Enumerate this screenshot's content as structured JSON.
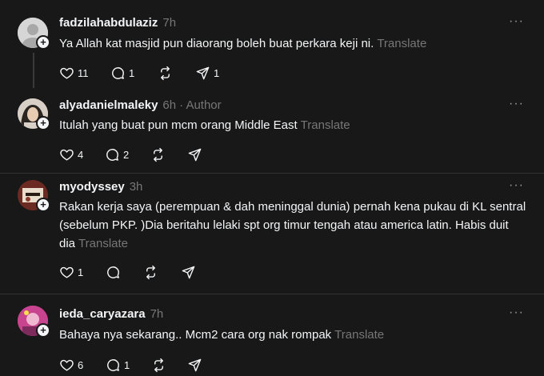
{
  "comments": [
    {
      "username": "fadzilahabdulaziz",
      "time": "7h",
      "author": "",
      "text": "Ya Allah kat masjid pun diaorang boleh buat perkara keji ni.",
      "translate": "Translate",
      "likes": "11",
      "replies": "1",
      "reposts": "",
      "shares": "1"
    },
    {
      "username": "alyadanielmaleky",
      "time": "6h",
      "author": "· Author",
      "text": "Itulah yang buat pun mcm orang Middle East",
      "translate": "Translate",
      "likes": "4",
      "replies": "2",
      "reposts": "",
      "shares": ""
    },
    {
      "username": "myodyssey",
      "time": "3h",
      "author": "",
      "text": "Rakan kerja saya (perempuan & dah meninggal dunia) pernah kena pukau di KL sentral (sebelum PKP. )Dia beritahu lelaki spt org timur tengah atau america latin. Habis duit dia",
      "translate": "Translate",
      "likes": "1",
      "replies": "",
      "reposts": "",
      "shares": ""
    },
    {
      "username": "ieda_caryazara",
      "time": "7h",
      "author": "",
      "text": "Bahaya nya sekarang.. Mcm2 cara org nak rompak",
      "translate": "Translate",
      "likes": "6",
      "replies": "1",
      "reposts": "",
      "shares": ""
    }
  ],
  "more_icon": "···",
  "colors": {
    "background": "#181818",
    "text": "#f3f5f7",
    "muted": "#777777",
    "divider": "#323232"
  }
}
